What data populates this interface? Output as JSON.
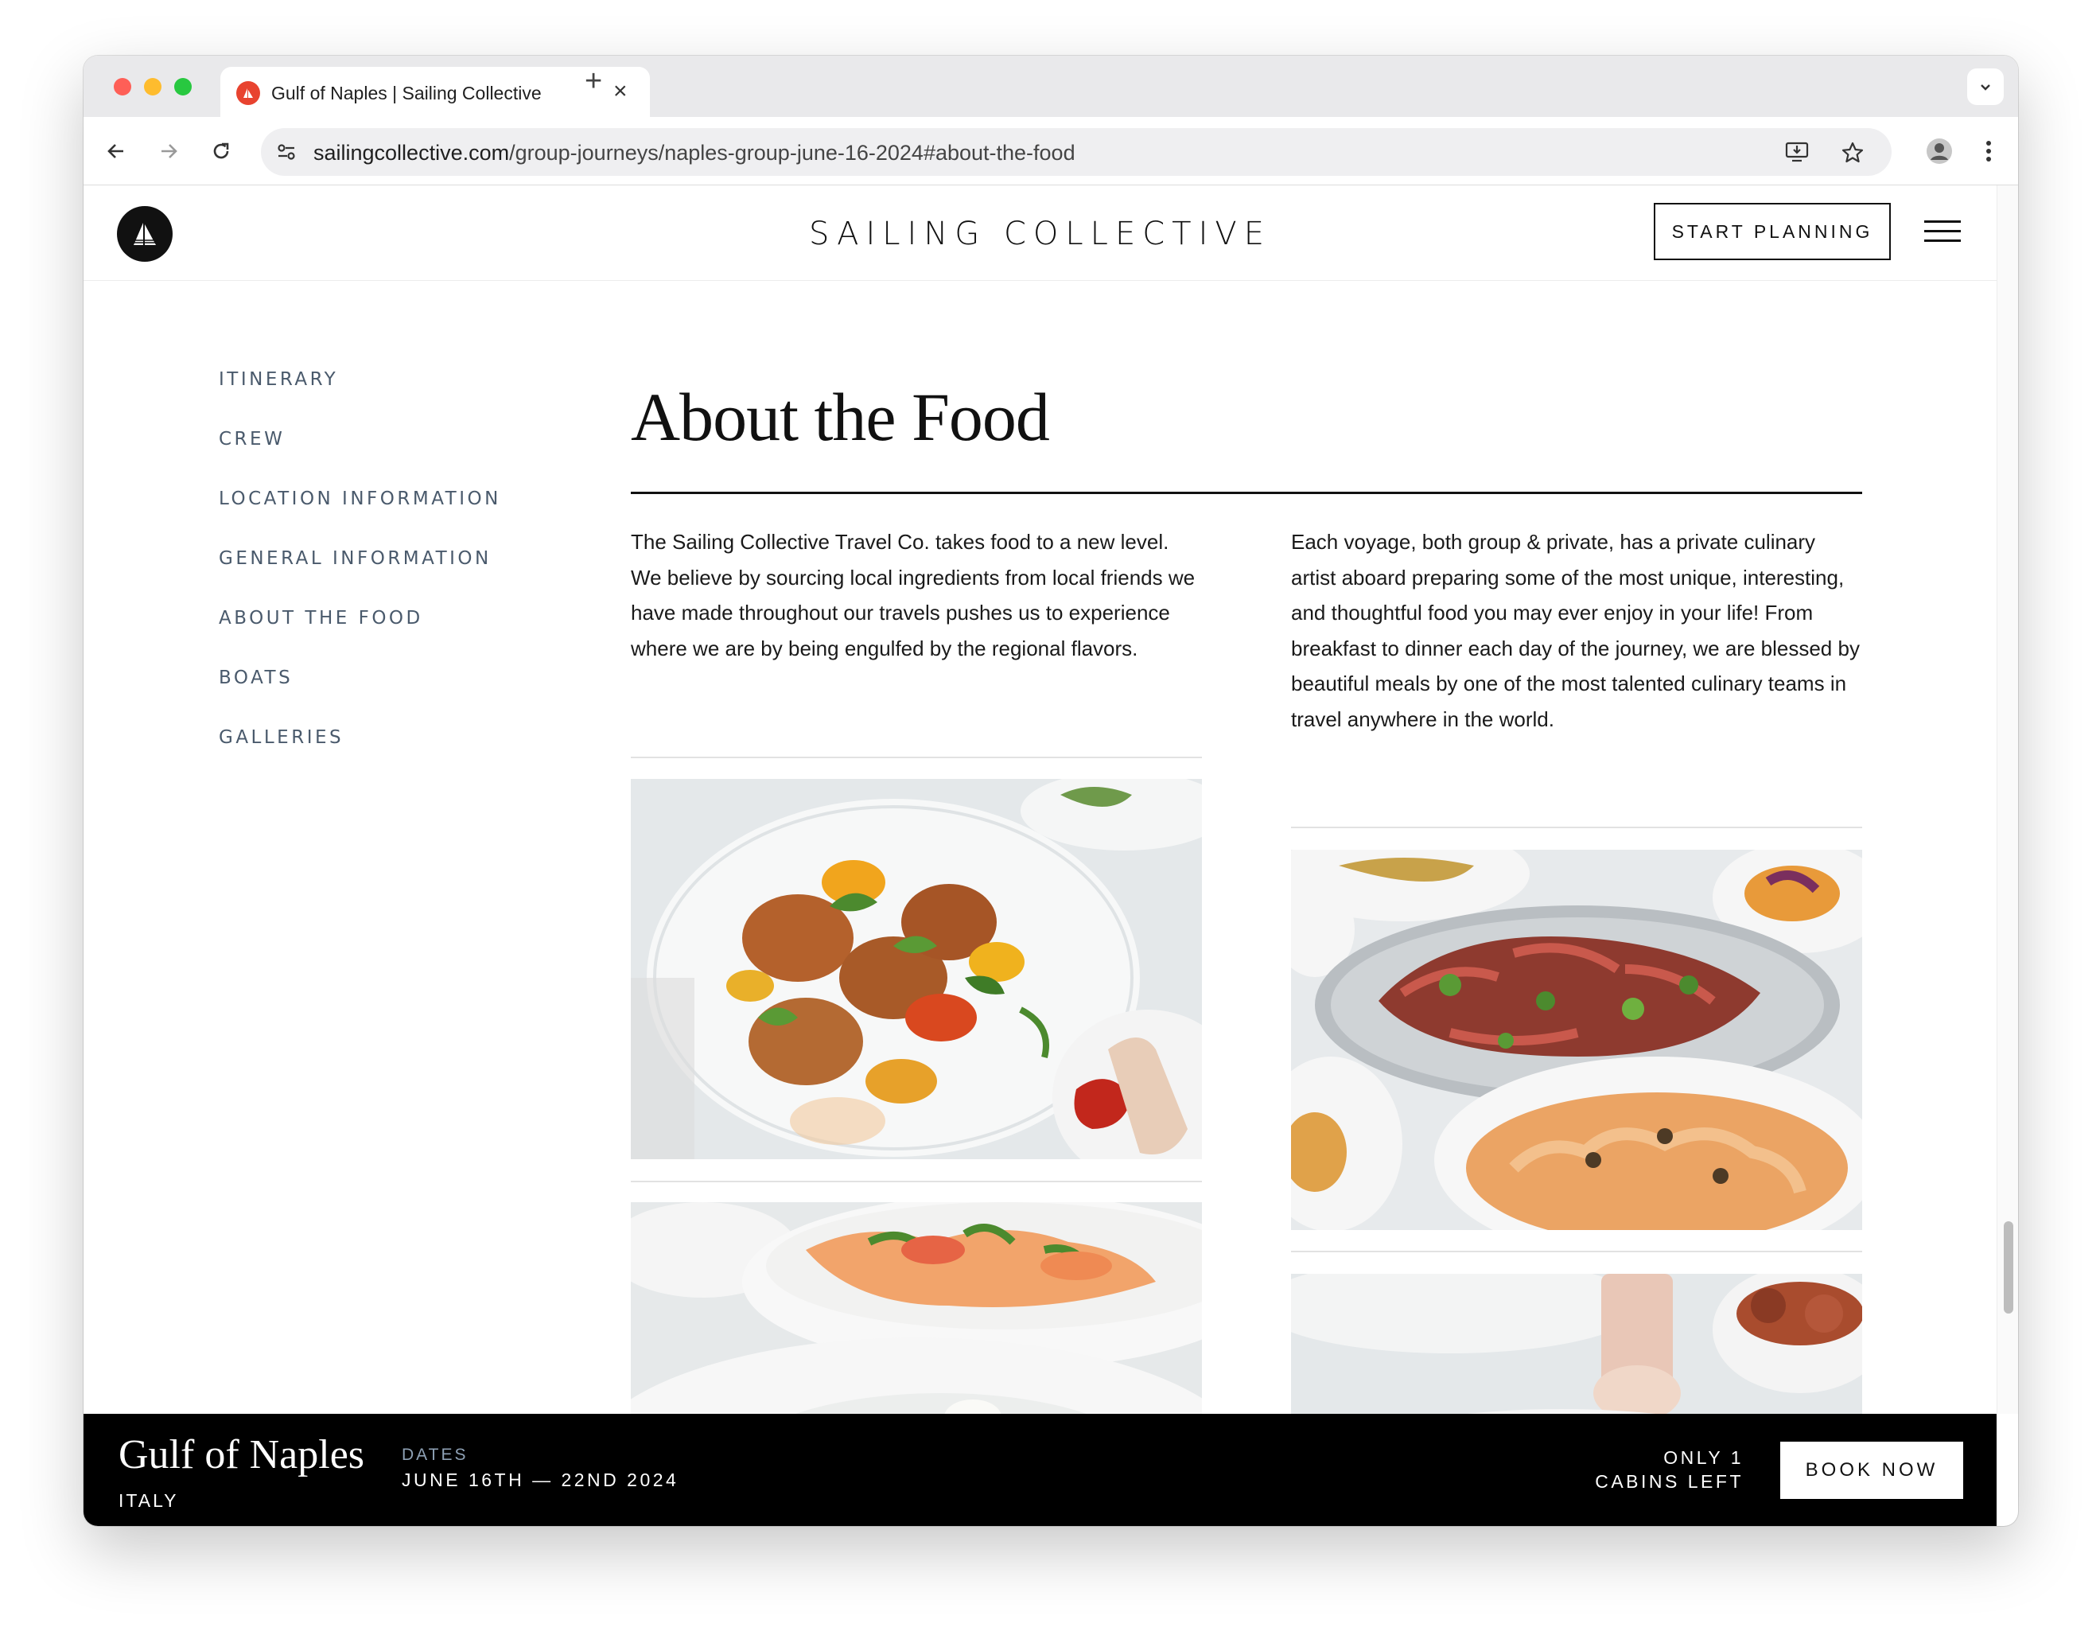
{
  "browser": {
    "tab_title": "Gulf of Naples | Sailing Collective",
    "url_domain": "sailingcollective.com",
    "url_path": "/group-journeys/naples-group-june-16-2024#about-the-food"
  },
  "header": {
    "brand": "SAILING COLLECTIVE",
    "cta": "START PLANNING"
  },
  "side_nav": {
    "items": [
      {
        "label": "ITINERARY"
      },
      {
        "label": "CREW"
      },
      {
        "label": "LOCATION INFORMATION"
      },
      {
        "label": "GENERAL INFORMATION"
      },
      {
        "label": "ABOUT THE FOOD"
      },
      {
        "label": "BOATS"
      },
      {
        "label": "GALLERIES"
      }
    ]
  },
  "main": {
    "title": "About the Food",
    "left_paragraph": "The Sailing Collective Travel Co. takes food to a new level. We believe by sourcing local ingredients from local friends we have made throughout our travels pushes us to experience where we are by being engulfed by the regional flavors.",
    "right_paragraph": "Each voyage, both group & private, has a private culinary artist aboard preparing some of the most unique, interesting, and thoughtful food you may ever enjoy in your life! From breakfast to dinner each day of the journey, we are blessed by beautiful meals by one of the most talented culinary teams in travel anywhere in the world."
  },
  "booking_bar": {
    "destination": "Gulf of Naples",
    "country": "ITALY",
    "dates_label": "DATES",
    "dates": "JUNE 16TH — 22ND 2024",
    "availability_line1": "ONLY 1",
    "availability_line2": "CABINS LEFT",
    "book_label": "BOOK NOW"
  },
  "colors": {
    "side_nav_text": "#4a5a6c",
    "dates_label": "#8ea1b5",
    "favicon": "#e8432f"
  },
  "icons": [
    "back-icon",
    "forward-icon",
    "reload-icon",
    "site-settings-icon",
    "install-app-icon",
    "bookmark-star-icon",
    "profile-icon",
    "more-vert-icon",
    "chevron-down-icon",
    "close-icon",
    "plus-icon",
    "sailboat-logo",
    "hamburger-menu-icon"
  ]
}
